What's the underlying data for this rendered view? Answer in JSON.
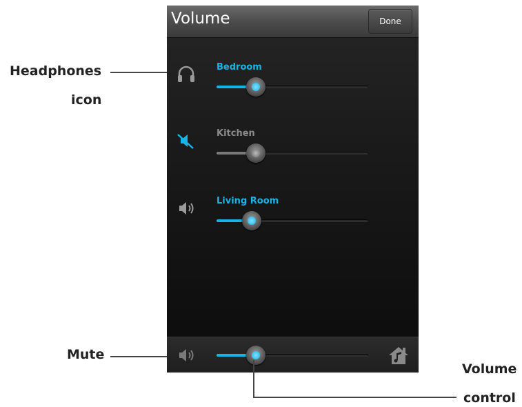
{
  "header": {
    "title": "Volume",
    "done_label": "Done"
  },
  "rows": [
    {
      "label": "Bedroom",
      "icon": "headphones-icon",
      "muted": false,
      "level": 0.26
    },
    {
      "label": "Kitchen",
      "icon": "mute-icon",
      "muted": true,
      "level": 0.26
    },
    {
      "label": "Living Room",
      "icon": "speaker-icon",
      "muted": false,
      "level": 0.23
    }
  ],
  "bottom": {
    "icon_left": "speaker-icon",
    "icon_right": "home-music-icon",
    "level": 0.26
  },
  "annotations": {
    "headphones_line1": "Headphones",
    "headphones_line2": "icon",
    "mute": "Mute",
    "volume_line1": "Volume",
    "volume_line2": "control"
  },
  "colors": {
    "accent": "#18b4e6",
    "muted_text": "#8a8a8a",
    "muted_fill": "#7a7a7a",
    "icon_gray": "#9a9a9a"
  }
}
